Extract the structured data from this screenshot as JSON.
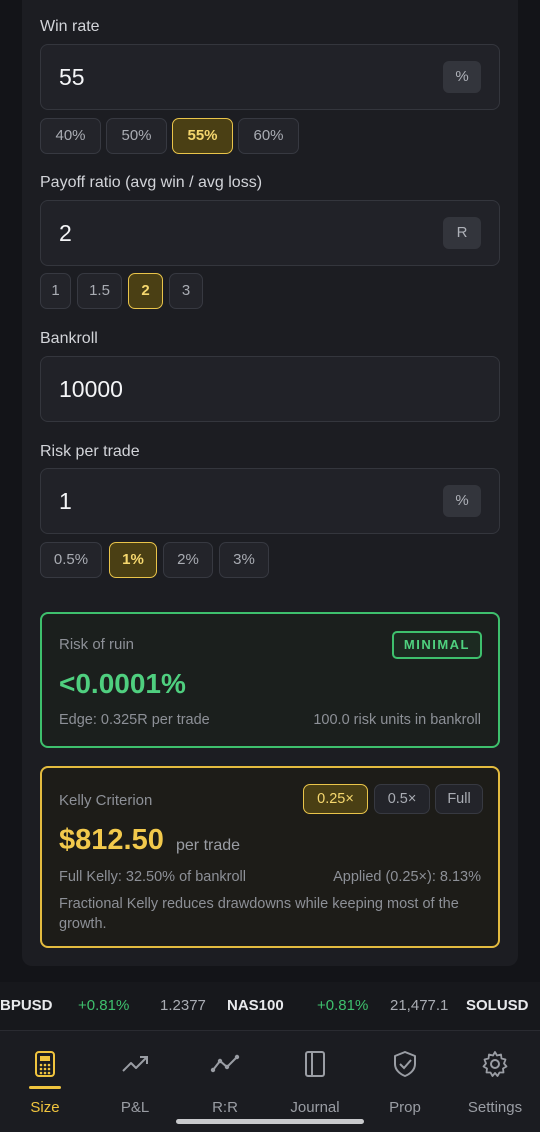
{
  "win_rate": {
    "label": "Win rate",
    "value": "55",
    "unit": "%",
    "presets": [
      "40%",
      "50%",
      "55%",
      "60%"
    ],
    "selected": "55%"
  },
  "payoff": {
    "label": "Payoff ratio (avg win / avg loss)",
    "value": "2",
    "unit": "R",
    "presets": [
      "1",
      "1.5",
      "2",
      "3"
    ],
    "selected": "2"
  },
  "bankroll": {
    "label": "Bankroll",
    "value": "10000"
  },
  "risk": {
    "label": "Risk per trade",
    "value": "1",
    "unit": "%",
    "presets": [
      "0.5%",
      "1%",
      "2%",
      "3%"
    ],
    "selected": "1%"
  },
  "ruin": {
    "title": "Risk of ruin",
    "badge": "MINIMAL",
    "value": "<0.0001%",
    "edge": "Edge: 0.325R per trade",
    "units": "100.0 risk units in bankroll",
    "color": "#3ec06d"
  },
  "kelly": {
    "title": "Kelly Criterion",
    "options": [
      "0.25×",
      "0.5×",
      "Full"
    ],
    "selected": "0.25×",
    "amount": "$812.50",
    "amount_suffix": "per trade",
    "full": "Full Kelly: 32.50% of bankroll",
    "applied": "Applied (0.25×): 8.13%",
    "note": "Fractional Kelly reduces drawdowns while keeping most of the growth.",
    "color": "#e3bb3f"
  },
  "ticker": [
    {
      "symbol": "BPUSD"
    },
    {
      "change": "+0.81%",
      "price": "1.2377"
    },
    {
      "symbol": "NAS100"
    },
    {
      "change": "+0.81%",
      "price": "21,477.1"
    },
    {
      "symbol": "SOLUSD"
    }
  ],
  "nav": {
    "items": [
      {
        "label": "Size",
        "icon": "calculator-icon",
        "active": true
      },
      {
        "label": "P&L",
        "icon": "trending-up-icon"
      },
      {
        "label": "R:R",
        "icon": "line-chart-icon"
      },
      {
        "label": "Journal",
        "icon": "book-icon"
      },
      {
        "label": "Prop",
        "icon": "shield-check-icon"
      },
      {
        "label": "Settings",
        "icon": "gear-icon"
      }
    ],
    "active_color": "#f0c43e"
  }
}
